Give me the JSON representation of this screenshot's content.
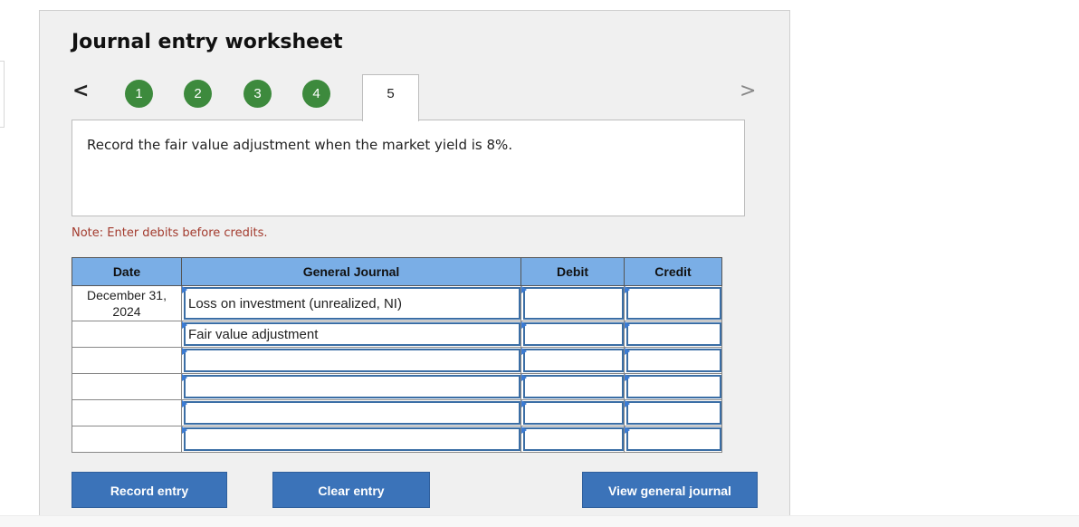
{
  "title": "Journal entry worksheet",
  "nav": {
    "prev_icon": "chevron-left-icon",
    "next_icon": "chevron-right-icon",
    "prev_glyph": "<",
    "next_glyph": ">"
  },
  "steps": [
    "1",
    "2",
    "3",
    "4",
    "5"
  ],
  "current_step": "5",
  "step_color": "#3d8a3d",
  "question": "Record the fair value adjustment when the market yield is 8%.",
  "note": "Note: Enter debits before credits.",
  "journal": {
    "headers": {
      "date": "Date",
      "account": "General Journal",
      "debit": "Debit",
      "credit": "Credit"
    },
    "rows": [
      {
        "date": "December 31, 2024",
        "account": "Loss on investment (unrealized, NI)",
        "debit": "",
        "credit": ""
      },
      {
        "date": "",
        "account": "Fair value adjustment",
        "debit": "",
        "credit": ""
      },
      {
        "date": "",
        "account": "",
        "debit": "",
        "credit": ""
      },
      {
        "date": "",
        "account": "",
        "debit": "",
        "credit": ""
      },
      {
        "date": "",
        "account": "",
        "debit": "",
        "credit": ""
      },
      {
        "date": "",
        "account": "",
        "debit": "",
        "credit": ""
      }
    ]
  },
  "buttons": {
    "record": "Record entry",
    "clear": "Clear entry",
    "view": "View general journal"
  },
  "colors": {
    "header_bg": "#7aaee6",
    "button_bg": "#3b73b9",
    "note": "#a33b2e"
  }
}
